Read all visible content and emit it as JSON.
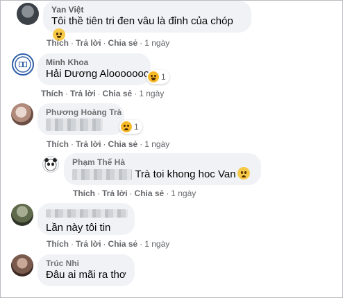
{
  "actions": {
    "like": "Thích",
    "reply": "Trả lời",
    "share": "Chia sẻ",
    "separator": "·"
  },
  "comments": [
    {
      "author": "Yan Việt",
      "text": "Tôi thề tiên tri đen vâu là đỉnh của chóp",
      "time": "1 ngày",
      "emoji": "grinning-emoji"
    },
    {
      "author": "Minh Khoa",
      "text": "Hải Dương Alooooooo",
      "time": "1 ngày",
      "reaction": {
        "icon": "haha-reaction-icon",
        "count": "1"
      }
    },
    {
      "author": "Phương Hoàng Trà",
      "text": "",
      "time": "1 ngày",
      "reaction": {
        "icon": "sad-reaction-icon",
        "count": "1"
      }
    },
    {
      "author": "Phạm Thế Hà",
      "text": "Trà toi khong hoc Van",
      "time": "1 ngày",
      "emoji": "sad-emoji",
      "is_reply": true
    },
    {
      "author": "",
      "text": "Lần này tôi tin",
      "time": "1 ngày"
    },
    {
      "author": "Trúc Nhi",
      "text": "Đâu ai mãi ra thơ",
      "time": "1 ngày"
    }
  ],
  "colors": {
    "bubble": "#f0f2f5",
    "meta": "#65676b",
    "text": "#050505",
    "reaction_yellow": "#f7b928"
  }
}
